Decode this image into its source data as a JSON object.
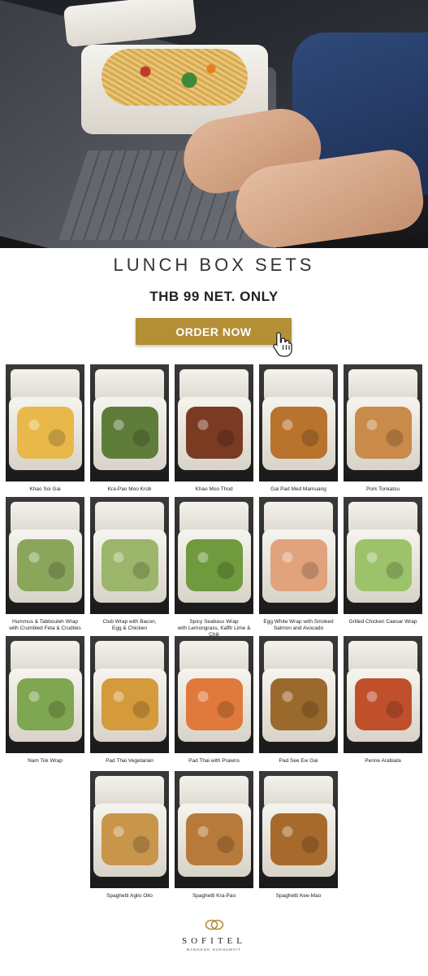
{
  "header": {
    "title": "LUNCH BOX SETS",
    "price": "THB 99 NET. ONLY",
    "cta_label": "ORDER NOW"
  },
  "colors": {
    "accent": "#b38f36"
  },
  "menu": [
    {
      "name": "Khao Soi Gai",
      "dish": "#e8b94a"
    },
    {
      "name": "Kra-Pao Moo Krob",
      "dish": "#5f7d3a"
    },
    {
      "name": "Khao Moo Thod",
      "dish": "#7a3b22"
    },
    {
      "name": "Gai Pad Med Mamuang",
      "dish": "#b8732d"
    },
    {
      "name": "Pork Tonkatsu",
      "dish": "#c98a4a"
    },
    {
      "name": "Hummus & Tabbouleh Wrap\nwith Crumbled Feta & Crudités",
      "dish": "#8aa65a"
    },
    {
      "name": "Club Wrap with Bacon,\nEgg & Chicken",
      "dish": "#9bb56a"
    },
    {
      "name": "Spicy Seabass Wrap\nwith Lemongrass, Kaffir Lime & Chili",
      "dish": "#6f9a3e"
    },
    {
      "name": "Egg White Wrap with Smoked\nSalmon and Avocado",
      "dish": "#e0a37c"
    },
    {
      "name": "Grilled Chicken Caesar Wrap",
      "dish": "#9cc26a"
    },
    {
      "name": "Nam Tok Wrap",
      "dish": "#7fa650"
    },
    {
      "name": "Pad Thai Vegetarian",
      "dish": "#d59a3c"
    },
    {
      "name": "Pad Thai with Prawns",
      "dish": "#e07a3c"
    },
    {
      "name": "Pad See Ew Gai",
      "dish": "#9a6a2c"
    },
    {
      "name": "Penne Arabiata",
      "dish": "#c0502c"
    },
    {
      "name": "Spaghetti Aglio Olio",
      "dish": "#c8964a"
    },
    {
      "name": "Spaghetti Kra-Pao",
      "dish": "#b87a3a"
    },
    {
      "name": "Spaghetti Kee-Mao",
      "dish": "#a86a2c"
    }
  ],
  "footer": {
    "brand": "SOFITEL",
    "location": "BANGKOK SUKHUMVIT"
  }
}
